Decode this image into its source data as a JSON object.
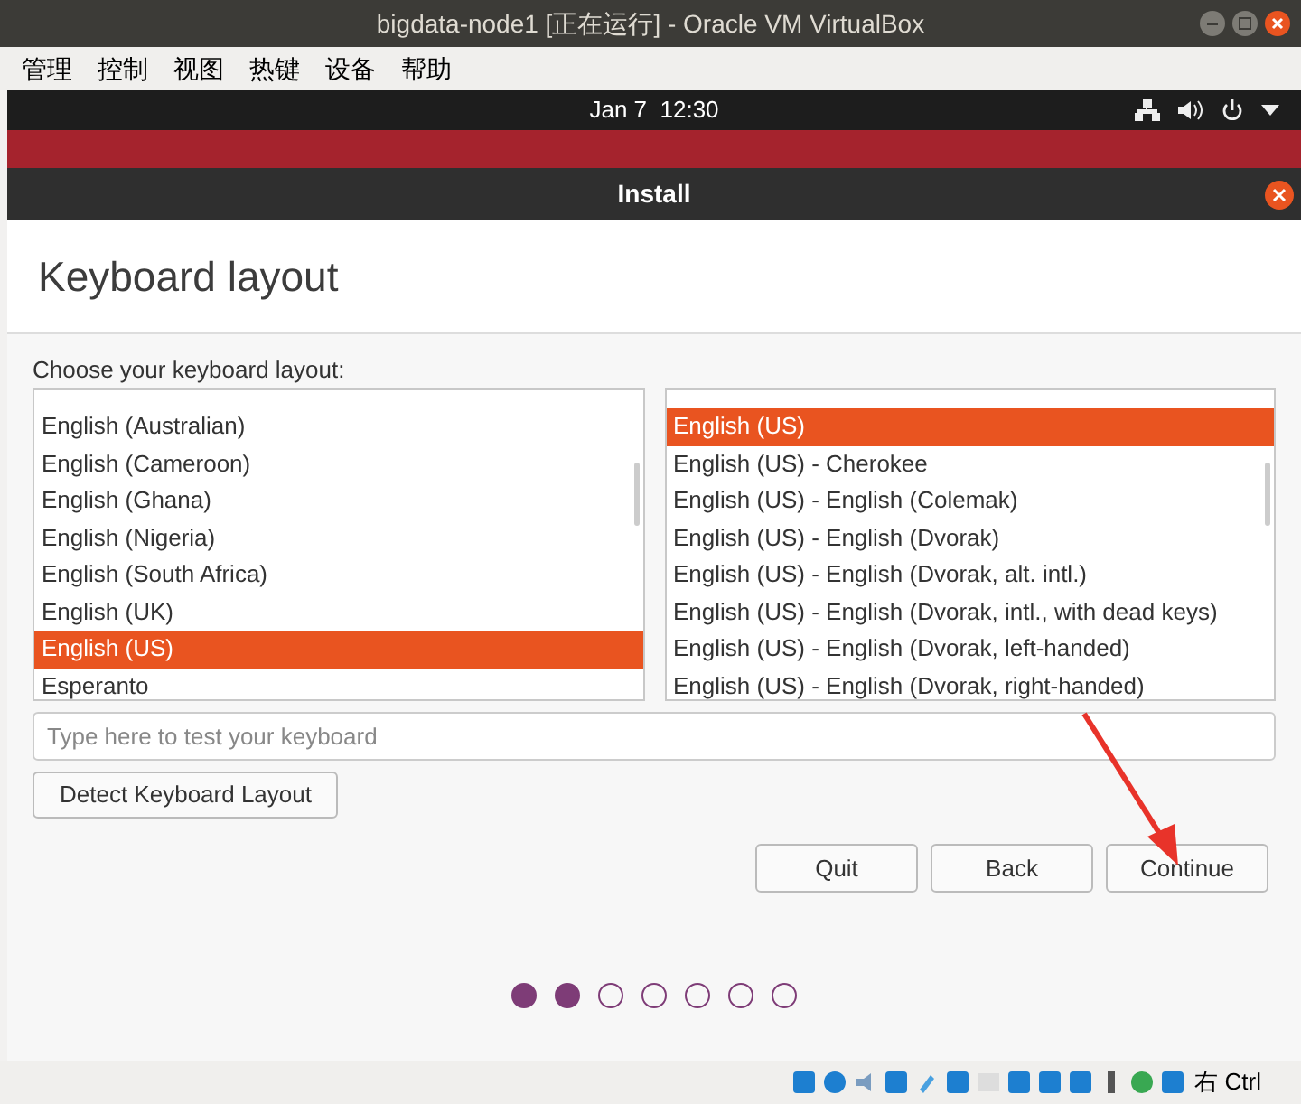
{
  "window": {
    "title": "bigdata-node1 [正在运行] - Oracle VM VirtualBox"
  },
  "menu": [
    "管理",
    "控制",
    "视图",
    "热键",
    "设备",
    "帮助"
  ],
  "top_bar": {
    "clock": "Jan 7  12:30"
  },
  "dialog": {
    "title": "Install",
    "heading": "Keyboard layout",
    "prompt": "Choose your keyboard layout:"
  },
  "layouts": [
    {
      "label": "English (Australian)",
      "selected": false
    },
    {
      "label": "English (Cameroon)",
      "selected": false
    },
    {
      "label": "English (Ghana)",
      "selected": false
    },
    {
      "label": "English (Nigeria)",
      "selected": false
    },
    {
      "label": "English (South Africa)",
      "selected": false
    },
    {
      "label": "English (UK)",
      "selected": false
    },
    {
      "label": "English (US)",
      "selected": true
    },
    {
      "label": "Esperanto",
      "selected": false
    }
  ],
  "variants": [
    {
      "label": "English (US)",
      "selected": true
    },
    {
      "label": "English (US) - Cherokee",
      "selected": false
    },
    {
      "label": "English (US) - English (Colemak)",
      "selected": false
    },
    {
      "label": "English (US) - English (Dvorak)",
      "selected": false
    },
    {
      "label": "English (US) - English (Dvorak, alt. intl.)",
      "selected": false
    },
    {
      "label": "English (US) - English (Dvorak, intl., with dead keys)",
      "selected": false
    },
    {
      "label": "English (US) - English (Dvorak, left-handed)",
      "selected": false
    },
    {
      "label": "English (US) - English (Dvorak, right-handed)",
      "selected": false
    }
  ],
  "test_field": {
    "placeholder": "Type here to test your keyboard"
  },
  "detect_button": "Detect Keyboard Layout",
  "nav_buttons": [
    "Quit",
    "Back",
    "Continue"
  ],
  "steps": [
    {
      "done": true
    },
    {
      "done": true
    },
    {
      "done": false
    },
    {
      "done": false
    },
    {
      "done": false
    },
    {
      "done": false
    },
    {
      "done": false
    }
  ],
  "status_bar": {
    "host_key": "右 Ctrl"
  }
}
